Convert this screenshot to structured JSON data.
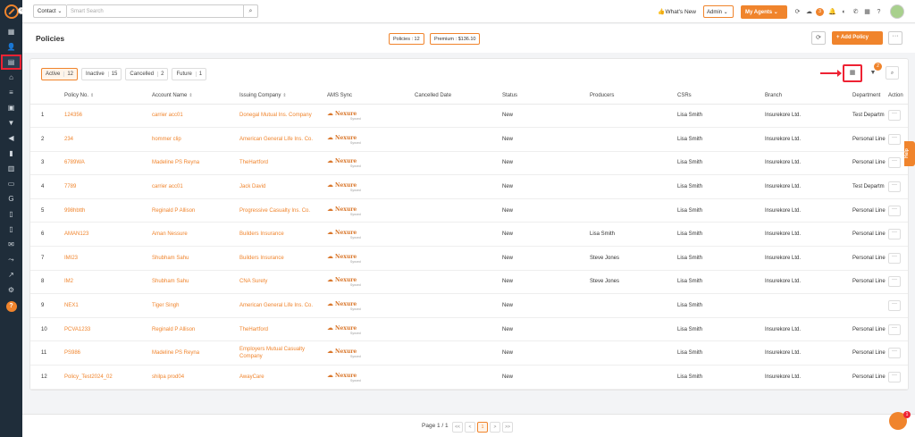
{
  "topbar": {
    "context_select": "Contact",
    "search_placeholder": "Smart Search",
    "whats_new": "What's New",
    "admin_select": "Admin",
    "my_agents": "My Agents",
    "notif_count": "3"
  },
  "page": {
    "title": "Policies",
    "policies_badge": "Policies : 12",
    "premium_badge": "Premium : $136.10",
    "add_policy": "+ Add Policy"
  },
  "filters": [
    {
      "label": "Active",
      "count": "12"
    },
    {
      "label": "Inactive",
      "count": "15"
    },
    {
      "label": "Cancelled",
      "count": "2"
    },
    {
      "label": "Future",
      "count": "1"
    }
  ],
  "filter_badge": "2",
  "columns": [
    "Policy No.",
    "Account Name",
    "Issuing Company",
    "AMS Sync",
    "Cancelled Date",
    "Status",
    "Producers",
    "CSRs",
    "Branch",
    "Department",
    "Action"
  ],
  "ams_logo": {
    "name": "Nexure",
    "sub": "Synced"
  },
  "rows": [
    {
      "num": "1",
      "policy": "124356",
      "account": "carrier acc01",
      "company": "Donegal Mutual Ins. Company",
      "status": "New",
      "producer": "",
      "csr": "Lisa Smith",
      "branch": "Insurekore Ltd.",
      "dept": "Test Departm"
    },
    {
      "num": "2",
      "policy": "234",
      "account": "hommer clip",
      "company": "American General Life Ins. Co.",
      "status": "New",
      "producer": "",
      "csr": "Lisa Smith",
      "branch": "Insurekore Ltd.",
      "dept": "Personal Line"
    },
    {
      "num": "3",
      "policy": "6789WA",
      "account": "Madeline PS Reyna",
      "company": "TheHartford",
      "status": "New",
      "producer": "",
      "csr": "Lisa Smith",
      "branch": "Insurekore Ltd.",
      "dept": "Personal Line"
    },
    {
      "num": "4",
      "policy": "7789",
      "account": "carrier acc01",
      "company": "Jack David",
      "status": "New",
      "producer": "",
      "csr": "Lisa Smith",
      "branch": "Insurekore Ltd.",
      "dept": "Test Departm"
    },
    {
      "num": "5",
      "policy": "998hbtth",
      "account": "Reginald P Allison",
      "company": "Progressive Casualty Ins. Co.",
      "status": "New",
      "producer": "",
      "csr": "Lisa Smith",
      "branch": "Insurekore Ltd.",
      "dept": "Personal Line"
    },
    {
      "num": "6",
      "policy": "AMAN123",
      "account": "Aman Nessure",
      "company": "Builders Insurance",
      "status": "New",
      "producer": "Lisa Smith",
      "csr": "Lisa Smith",
      "branch": "Insurekore Ltd.",
      "dept": "Personal Line"
    },
    {
      "num": "7",
      "policy": "IMI23",
      "account": "Shubham Sahu",
      "company": "Builders Insurance",
      "status": "New",
      "producer": "Steve Jones",
      "csr": "Lisa Smith",
      "branch": "Insurekore Ltd.",
      "dept": "Personal Line"
    },
    {
      "num": "8",
      "policy": "IM2",
      "account": "Shubham Sahu",
      "company": "CNA Surety",
      "status": "New",
      "producer": "Steve Jones",
      "csr": "Lisa Smith",
      "branch": "Insurekore Ltd.",
      "dept": "Personal Line"
    },
    {
      "num": "9",
      "policy": "NEX1",
      "account": "Tiger Singh",
      "company": "American General Life Ins. Co.",
      "status": "New",
      "producer": "",
      "csr": "Lisa Smith",
      "branch": "",
      "dept": ""
    },
    {
      "num": "10",
      "policy": "PCVA1233",
      "account": "Reginald P Allison",
      "company": "TheHartford",
      "status": "New",
      "producer": "",
      "csr": "Lisa Smith",
      "branch": "Insurekore Ltd.",
      "dept": "Personal Line"
    },
    {
      "num": "11",
      "policy": "PS986",
      "account": "Madeline PS Reyna",
      "company": "Employers Mutual Casualty Company",
      "status": "New",
      "producer": "",
      "csr": "Lisa Smith",
      "branch": "Insurekore Ltd.",
      "dept": "Personal Line"
    },
    {
      "num": "12",
      "policy": "Policy_Test2024_02",
      "account": "shilpa prod04",
      "company": "AwayCare",
      "status": "New",
      "producer": "",
      "csr": "Lisa Smith",
      "branch": "Insurekore Ltd.",
      "dept": "Personal Line"
    }
  ],
  "pager": {
    "text": "Page 1 / 1",
    "first": "<<",
    "prev": "<",
    "current": "1",
    "next": ">",
    "last": ">>"
  },
  "help_tab": "Help",
  "chat_badge": "1",
  "colors": {
    "accent": "#f0842c",
    "sidebar": "#1f2d3a",
    "highlight": "#e22233"
  },
  "icons": {
    "sidebar": [
      "dashboard-icon",
      "users-icon",
      "policy-icon",
      "bank-icon",
      "list-icon",
      "badge-icon",
      "filter-icon",
      "megaphone-icon",
      "book-icon",
      "chart-icon",
      "folder-icon",
      "google-icon",
      "document-icon",
      "clipboard-icon",
      "mail-icon",
      "route-icon",
      "analytics-icon",
      "gear-icon",
      "help-icon"
    ]
  }
}
